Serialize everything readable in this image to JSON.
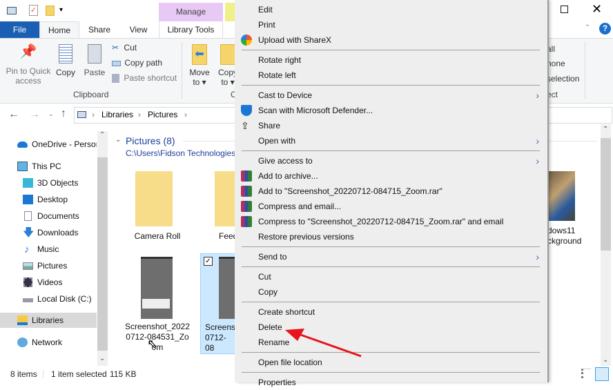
{
  "window": {
    "manage_tab": "Manage",
    "library_tools_tab": "Library Tools"
  },
  "tabs": {
    "file": "File",
    "home": "Home",
    "share": "Share",
    "view": "View"
  },
  "ribbon": {
    "pin": "Pin to Quick access",
    "copy": "Copy",
    "paste": "Paste",
    "cut": "Cut",
    "copy_path": "Copy path",
    "paste_shortcut": "Paste shortcut",
    "clipboard_group": "Clipboard",
    "move_to": "Move to ▾",
    "copy_to": "Copy to ▾",
    "organize_group_partial": "O",
    "select_all_partial": "all",
    "select_none_partial": "none",
    "invert_selection_partial": "selection",
    "select_group_partial": "ect"
  },
  "address": {
    "crumbs": [
      "Libraries",
      "Pictures"
    ]
  },
  "nav": {
    "items": [
      {
        "label": "OneDrive - Persor",
        "icon": "onedrive-icon"
      },
      {
        "label": "This PC",
        "icon": "pc-icon"
      },
      {
        "label": "3D Objects",
        "icon": "cube-icon"
      },
      {
        "label": "Desktop",
        "icon": "desktop-icon"
      },
      {
        "label": "Documents",
        "icon": "documents-icon"
      },
      {
        "label": "Downloads",
        "icon": "download-icon"
      },
      {
        "label": "Music",
        "icon": "music-icon"
      },
      {
        "label": "Pictures",
        "icon": "pictures-icon"
      },
      {
        "label": "Videos",
        "icon": "videos-icon"
      },
      {
        "label": "Local Disk (C:)",
        "icon": "drive-icon"
      },
      {
        "label": "Libraries",
        "icon": "libraries-icon"
      },
      {
        "label": "Network",
        "icon": "network-icon"
      }
    ]
  },
  "content": {
    "group_title": "Pictures (8)",
    "path": "C:\\Users\\Fidson Technologies",
    "items": [
      {
        "name": "Camera Roll"
      },
      {
        "name": "Feed"
      },
      {
        "name": "dows11 ckground"
      },
      {
        "name": "Screenshot_20220712-084531_Zoom"
      },
      {
        "name": "Screens 0712-08"
      }
    ]
  },
  "status": {
    "count": "8 items",
    "selection": "1 item selected",
    "size": "115 KB"
  },
  "menu": [
    {
      "label": "Edit"
    },
    {
      "label": "Print"
    },
    {
      "label": "Upload with ShareX",
      "icon": "sharex-icon"
    },
    {
      "sep": true
    },
    {
      "label": "Rotate right"
    },
    {
      "label": "Rotate left"
    },
    {
      "sep": true
    },
    {
      "label": "Cast to Device",
      "sub": true
    },
    {
      "label": "Scan with Microsoft Defender...",
      "icon": "defender-icon"
    },
    {
      "label": "Share",
      "icon": "share-icon"
    },
    {
      "label": "Open with",
      "sub": true
    },
    {
      "sep": true
    },
    {
      "label": "Give access to",
      "sub": true
    },
    {
      "label": "Add to archive...",
      "icon": "winrar-icon"
    },
    {
      "label": "Add to \"Screenshot_20220712-084715_Zoom.rar\"",
      "icon": "winrar-icon"
    },
    {
      "label": "Compress and email...",
      "icon": "winrar-icon"
    },
    {
      "label": "Compress to \"Screenshot_20220712-084715_Zoom.rar\" and email",
      "icon": "winrar-icon"
    },
    {
      "label": "Restore previous versions"
    },
    {
      "sep": true
    },
    {
      "label": "Send to",
      "sub": true
    },
    {
      "sep": true
    },
    {
      "label": "Cut"
    },
    {
      "label": "Copy"
    },
    {
      "sep": true
    },
    {
      "label": "Create shortcut"
    },
    {
      "label": "Delete"
    },
    {
      "label": "Rename"
    },
    {
      "sep": true
    },
    {
      "label": "Open file location"
    },
    {
      "sep": true
    },
    {
      "label": "Properties"
    }
  ],
  "colors": {
    "accent": "#1a5fb4",
    "annotation_arrow": "#e8141c",
    "selection": "#cce8ff"
  }
}
